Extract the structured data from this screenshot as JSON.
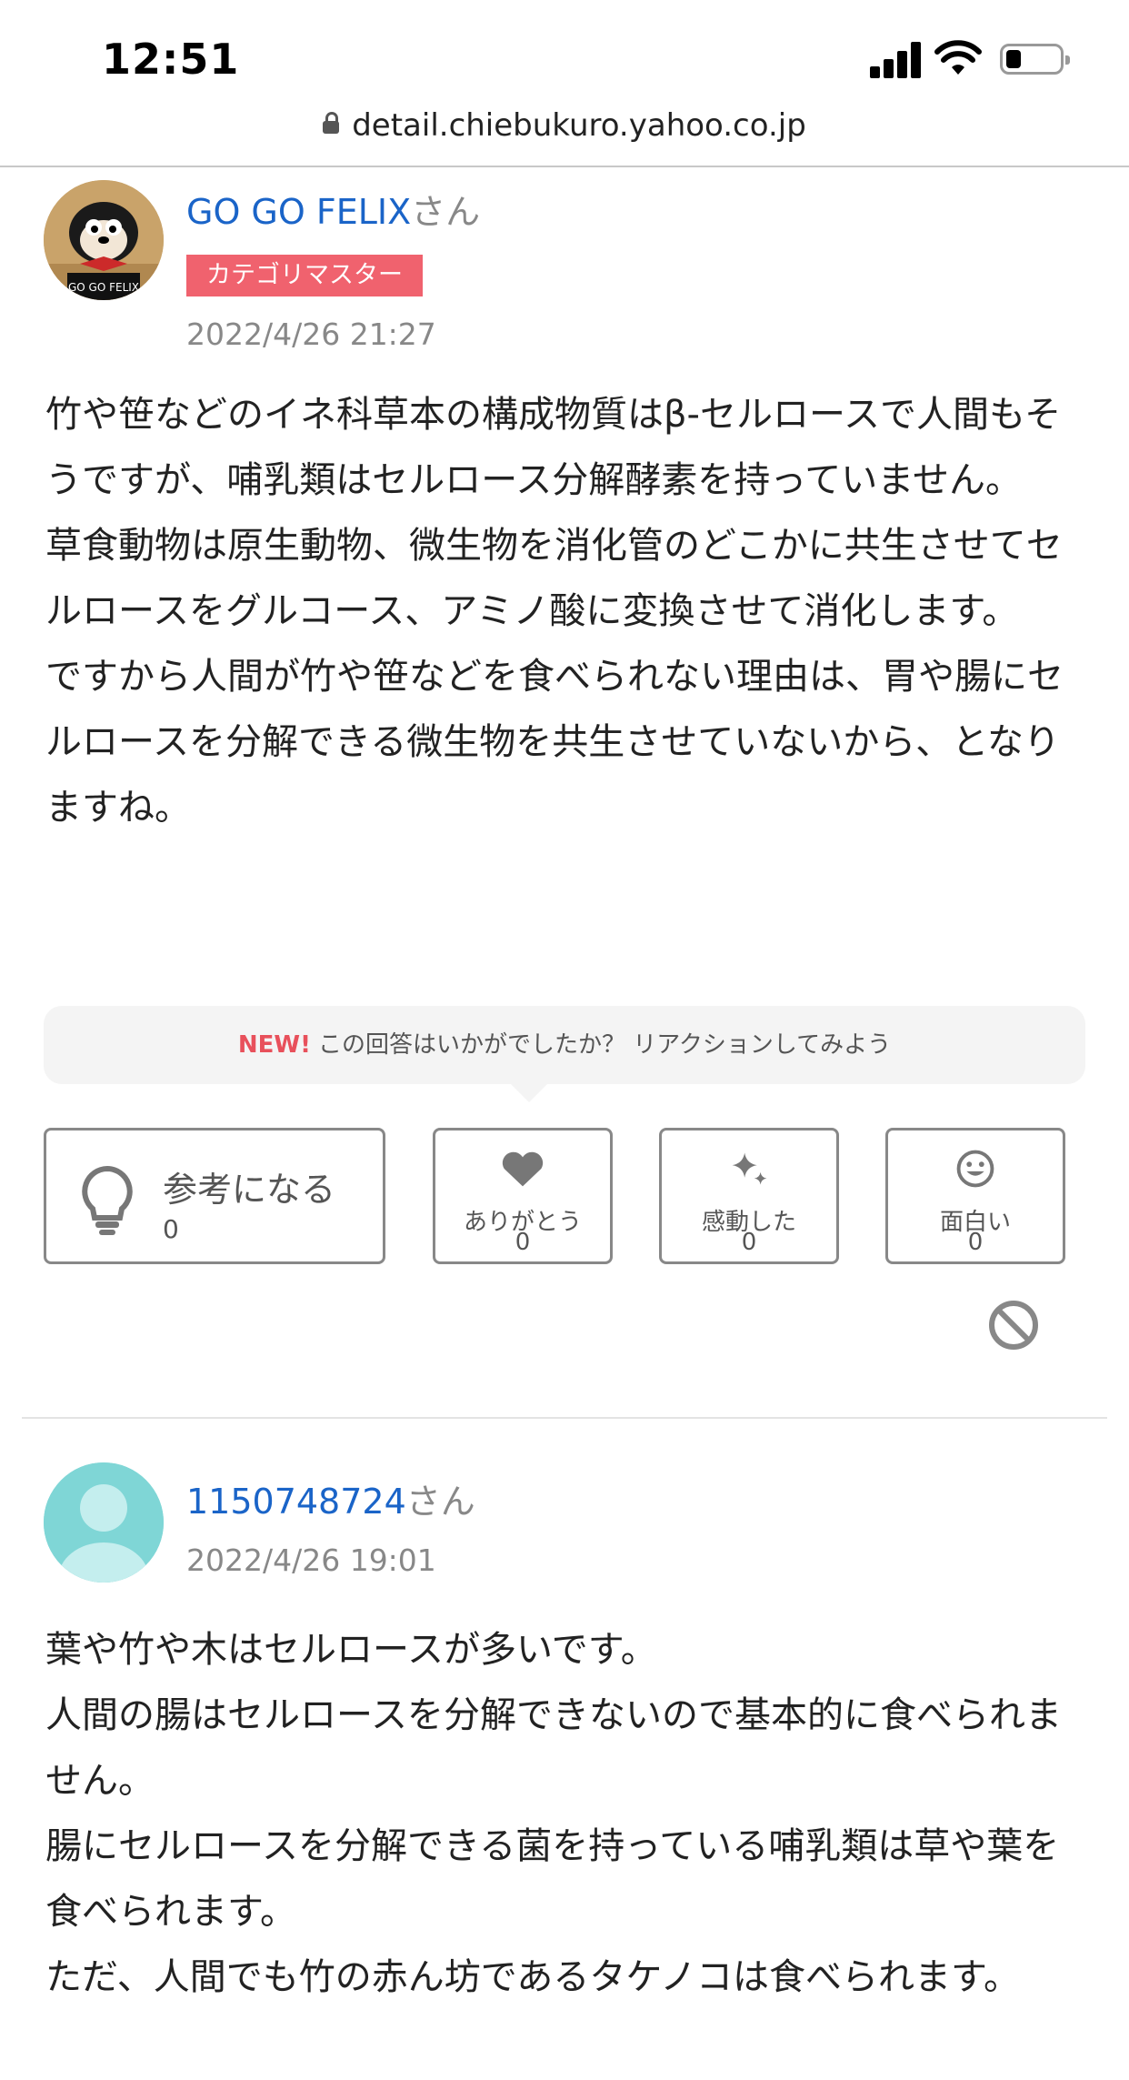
{
  "status_bar": {
    "time": "12:51"
  },
  "browser": {
    "url": "detail.chiebukuro.yahoo.co.jp"
  },
  "answer1": {
    "user_name": "GO GO FELIX",
    "honorific": "さん",
    "badge": "カテゴリマスター",
    "avatar_text": "GO GO FELIX",
    "date": "2022/4/26 21:27",
    "paragraphs": [
      "竹や笹などのイネ科草本の構成物質はβ-セルロースで人間もそうですが、哺乳類はセルロース分解酵素を持っていません。",
      "草食動物は原生動物、微生物を消化管のどこかに共生させてセルロースをグルコース、アミノ酸に変換させて消化します。",
      "ですから人間が竹や笹などを食べられない理由は、胃や腸にセルロースを分解できる微生物を共生させていないから、となりますね。"
    ]
  },
  "reaction_prompt": {
    "new_label": "NEW!",
    "text": "この回答はいかがでしたか？ リアクションしてみよう"
  },
  "reactions": {
    "helpful": {
      "label": "参考になる",
      "count": "0"
    },
    "thanks": {
      "label": "ありがとう",
      "count": "0"
    },
    "moved": {
      "label": "感動した",
      "count": "0"
    },
    "funny": {
      "label": "面白い",
      "count": "0"
    }
  },
  "answer2": {
    "user_name": "1150748724",
    "honorific": "さん",
    "date": "2022/4/26 19:01",
    "paragraphs": [
      "葉や竹や木はセルロースが多いです。",
      "人間の腸はセルロースを分解できないので基本的に食べられません。",
      "腸にセルロースを分解できる菌を持っている哺乳類は草や葉を食べられます。",
      "ただ、人間でも竹の赤ん坊であるタケノコは食べられます。"
    ]
  },
  "icons": {
    "helpful": "lightbulb-icon",
    "thanks": "heart-icon",
    "moved": "sparkle-icon",
    "funny": "smile-icon",
    "report": "ban-icon"
  },
  "colors": {
    "link": "#1a64c8",
    "badge": "#f0626e",
    "new": "#e8505b"
  }
}
